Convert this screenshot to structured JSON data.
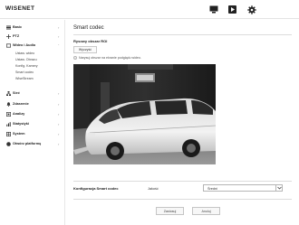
{
  "header": {
    "logo": "WISENET",
    "icons": [
      "monitor-icon",
      "play-icon",
      "gear-icon"
    ]
  },
  "sidebar": {
    "items": [
      {
        "label": "Basic",
        "icon": "basic-icon"
      },
      {
        "label": "PTZ",
        "icon": "ptz-icon"
      },
      {
        "label": "Wideo i Audio",
        "icon": "video-audio-icon",
        "expanded": true
      },
      {
        "label": "Sieć",
        "icon": "network-icon"
      },
      {
        "label": "Zdarzenie",
        "icon": "event-icon"
      },
      {
        "label": "Analizy",
        "icon": "analytics-icon"
      },
      {
        "label": "Statystyki",
        "icon": "statistics-icon"
      },
      {
        "label": "System",
        "icon": "system-icon"
      },
      {
        "label": "Otwórz platformę",
        "icon": "open-platform-icon"
      }
    ],
    "subitems": [
      "Ustaw. wideo",
      "Ustaw. Obrazu",
      "Konfig. Kamery",
      "Smart codec",
      "WiseStream"
    ]
  },
  "main": {
    "title": "Smart codec",
    "roi_label": "Rysowy obszar ROI",
    "clear_button": "Wyczyść",
    "hint": "Narysuj obszar na ekranie podglądu wideo.",
    "config_label": "Konfiguracja Smart codec",
    "quality_label": "Jakość",
    "quality_value": "Średni",
    "apply_button": "Zastosuj",
    "cancel_button": "Anuluj"
  }
}
